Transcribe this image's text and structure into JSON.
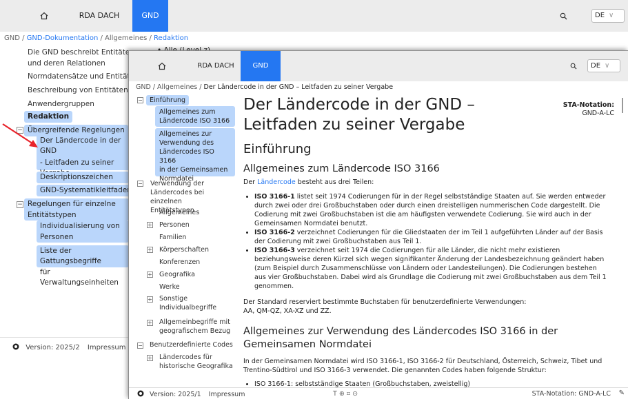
{
  "back": {
    "topbar": {
      "home_icon": "home-icon",
      "site": "RDA DACH",
      "active": "GND",
      "search_icon": "search-icon",
      "lang": "DE"
    },
    "breadcrumb": {
      "root": "GND",
      "sep": " / ",
      "doc": "GND-Dokumentation",
      "general": "Allgemeines",
      "current": "Redaktion"
    },
    "content_fragment": "Alle (Level z)",
    "nav": [
      "Die GND beschreibt Entitäten",
      "und deren Relationen",
      "Normdatensätze und Entitäten",
      "Beschreibung von Entitäten",
      "Anwendergruppen",
      "Redaktion",
      "Übergreifende Regelungen",
      "Der Ländercode in der GND",
      "- Leitfaden zu seiner",
      "Vergabe",
      "Deskriptionszeichen",
      "GND-Systematikleitfaden",
      "Regelungen für einzelne",
      "Entitätstypen",
      "Individualisierung von",
      "Personen",
      "Liste der Gattungsbegriffe",
      "für Verwaltungseinheiten"
    ],
    "footer": {
      "github_icon": "github-icon",
      "version": "Version: 2025/2",
      "imprint": "Impressum"
    }
  },
  "front": {
    "topbar": {
      "home_icon": "home-icon",
      "site": "RDA DACH",
      "active": "GND",
      "search_icon": "search-icon",
      "lang": "DE"
    },
    "breadcrumb": {
      "root": "GND",
      "general": "Allgemeines",
      "current": "Der Ländercode in der GND – Leitfaden zu seiner Vergabe"
    },
    "nav": [
      "Einführung",
      "Allgemeines zum",
      "Ländercode ISO 3166",
      "Allgemeines zur",
      "Verwendung des",
      "Ländercodes ISO 3166",
      "in der Gemeinsamen",
      "Normdatei",
      "Verwendung der",
      "Ländercodes bei einzelnen",
      "Entitätstypen",
      "Allgemeines",
      "Personen",
      "Familien",
      "Körperschaften",
      "Konferenzen",
      "Geografika",
      "Werke",
      "Sonstige",
      "Individualbegriffe",
      "Allgemeinbegriffe mit",
      "geografischem Bezug",
      "Benutzerdefinierte Codes",
      "Ländercodes für",
      "historische Geografika"
    ],
    "main": {
      "title_line1": "Der Ländercode in der GND –",
      "title_line2": "Leitfaden zu seiner Vergabe",
      "sta_label": "STA-Notation:",
      "sta_value": "GND-A-LC",
      "h_intro": "Einführung",
      "h_iso": "Allgemeines zum Ländercode ISO 3166",
      "p1_pre": "Der ",
      "p1_link": "Ländercode",
      "p1_post": " besteht aus drei Teilen:",
      "b1_strong": "ISO 3166-1",
      "b1_text": " listet seit 1974 Codierungen für in der Regel selbstständige Staaten auf. Sie werden entweder durch zwei oder drei Großbuchstaben oder durch einen dreistelligen nummerischen Code dargestellt. Die Codierung mit zwei Großbuchstaben ist die am häufigsten verwendete Codierung. Sie wird auch in der Gemeinsamen Normdatei benutzt.",
      "b2_strong": "ISO 3166-2",
      "b2_text": " verzeichnet Codierungen für die Gliedstaaten der im Teil 1 aufgeführten Länder auf der Basis der Codierung mit zwei Großbuchstaben aus Teil 1.",
      "b3_strong": "ISO 3166-3",
      "b3_text": " verzeichnet seit 1974 die Codierungen für alle Länder, die nicht mehr existieren beziehungsweise deren Kürzel sich wegen signifikanter Änderung der Landesbezeichnung geändert haben (zum Beispiel durch Zusammenschlüsse von Ländern oder Landesteilungen). Die Codierungen bestehen aus vier Großbuchstaben. Dabei wird als Grundlage die Codierung mit zwei Großbuchstaben aus dem Teil 1 genommen.",
      "p2_line1": "Der Standard reserviert bestimmte Buchstaben für benutzerdefinierte Verwendungen:",
      "p2_line2": "AA, QM-QZ, XA-XZ und ZZ.",
      "h_usage": "Allgemeines zur Verwendung des Ländercodes ISO 3166 in der Gemeinsamen Normdatei",
      "p3": "In der Gemeinsamen Normdatei wird ISO 3166-1, ISO 3166-2 für Deutschland, Österreich, Schweiz, Tibet und Trentino-Südtirol und ISO 3166-3 verwendet. Die genannten Codes haben folgende Struktur:",
      "b4": "ISO 3166-1: selbstständige Staaten (Großbuchstaben, zweistellig)"
    },
    "footer": {
      "github_icon": "github-icon",
      "version": "Version: 2025/1",
      "imprint": "Impressum",
      "icons": "T ⊕ ⌗ ⊙",
      "sta": "STA-Notation: GND-A-LC",
      "edit_icon": "pencil-icon"
    }
  },
  "annotation": {
    "arrow_color": "#e8222a"
  }
}
